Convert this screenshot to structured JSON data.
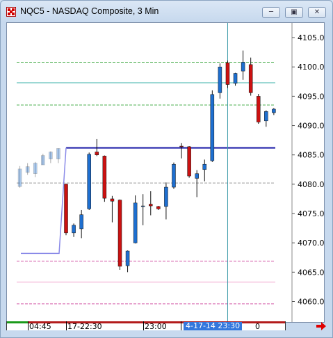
{
  "window": {
    "title": "NQC5 - NASDAQ Composite, 3 Min",
    "controls": {
      "minimize_icon": "minimize-icon",
      "restore_icon": "restore-icon",
      "close_icon": "close-icon"
    }
  },
  "time_axis": {
    "labels": [
      "04:45",
      "17-22:30",
      "23:00"
    ],
    "cursor_time": "4-17-14  23:30",
    "cursor_time_suffix": "0"
  },
  "colors": {
    "up": "#1e6fd0",
    "down": "#cc1111",
    "background": "#ffffff",
    "resistance_line": "#1a1aa8",
    "teal_line": "#38b0a8",
    "green_dash": "#4caf50",
    "pink_dash": "#d45aa8",
    "pink_solid": "#f0a0cc",
    "gray_dash": "#9a9a9a",
    "cursor": "#3a9aa8",
    "axis_label_bg": "#3377dd"
  },
  "chart_data": {
    "type": "candlestick",
    "title": "NQC5 - NASDAQ Composite, 3 Min",
    "ylim": [
      4056.5,
      4107.5
    ],
    "yticks": [
      4060.0,
      4065.0,
      4070.0,
      4075.0,
      4080.0,
      4085.0,
      4090.0,
      4095.0,
      4100.0,
      4105.0
    ],
    "ytick_labels": [
      "4060.0",
      "4065.0",
      "4070.0",
      "4075.0",
      "4080.0",
      "4085.0",
      "4090.0",
      "4095.0",
      "4100.0",
      "4105.0"
    ],
    "grid": false,
    "faded_candles": [
      {
        "i": -6,
        "o": 4079.6,
        "h": 4083.1,
        "c": 4082.6,
        "l": 4079.4
      },
      {
        "i": -5,
        "o": 4082.0,
        "h": 4083.6,
        "c": 4083.0,
        "l": 4081.6
      },
      {
        "i": -4,
        "o": 4081.8,
        "h": 4083.8,
        "c": 4083.6,
        "l": 4081.2
      },
      {
        "i": -3,
        "o": 4083.3,
        "h": 4085.2,
        "c": 4084.9,
        "l": 4083.3
      },
      {
        "i": -2,
        "o": 4084.3,
        "h": 4085.6,
        "c": 4085.5,
        "l": 4083.6
      },
      {
        "i": -1,
        "o": 4084.3,
        "h": 4086.1,
        "c": 4086.1,
        "l": 4083.6
      }
    ],
    "candles": [
      {
        "i": 0,
        "o": 4080.0,
        "h": 4080.1,
        "c": 4071.7,
        "l": 4071.3
      },
      {
        "i": 1,
        "o": 4071.7,
        "h": 4073.3,
        "c": 4073.0,
        "l": 4071.0
      },
      {
        "i": 2,
        "o": 4072.4,
        "h": 4075.6,
        "c": 4074.8,
        "l": 4070.8
      },
      {
        "i": 3,
        "o": 4075.8,
        "h": 4085.4,
        "c": 4085.1,
        "l": 4075.6
      },
      {
        "i": 4,
        "o": 4085.5,
        "h": 4087.7,
        "c": 4085.0,
        "l": 4084.8
      },
      {
        "i": 5,
        "o": 4084.8,
        "h": 4084.9,
        "c": 4077.6,
        "l": 4077.0
      },
      {
        "i": 6,
        "o": 4077.5,
        "h": 4078.0,
        "c": 4077.1,
        "l": 4073.5
      },
      {
        "i": 7,
        "o": 4077.3,
        "h": 4077.4,
        "c": 4066.0,
        "l": 4065.4
      },
      {
        "i": 8,
        "o": 4066.1,
        "h": 4068.7,
        "c": 4068.6,
        "l": 4065.0
      },
      {
        "i": 9,
        "o": 4070.0,
        "h": 4078.1,
        "c": 4076.8,
        "l": 4069.9
      },
      {
        "i": 10,
        "o": 4076.2,
        "h": 4078.3,
        "c": 4076.3,
        "l": 4073.0
      },
      {
        "i": 11,
        "o": 4076.6,
        "h": 4078.8,
        "c": 4076.3,
        "l": 4074.7
      },
      {
        "i": 12,
        "o": 4076.2,
        "h": 4076.3,
        "c": 4075.8,
        "l": 4075.6
      },
      {
        "i": 13,
        "o": 4076.2,
        "h": 4080.3,
        "c": 4079.5,
        "l": 4074.0
      },
      {
        "i": 14,
        "o": 4079.5,
        "h": 4083.7,
        "c": 4083.4,
        "l": 4079.2
      },
      {
        "i": 15,
        "o": 4086.5,
        "h": 4087.0,
        "c": 4086.4,
        "l": 4084.4
      },
      {
        "i": 16,
        "o": 4086.4,
        "h": 4086.5,
        "c": 4081.4,
        "l": 4081.1
      },
      {
        "i": 17,
        "o": 4081.0,
        "h": 4082.4,
        "c": 4081.8,
        "l": 4077.8
      },
      {
        "i": 18,
        "o": 4082.5,
        "h": 4084.2,
        "c": 4083.4,
        "l": 4080.5
      },
      {
        "i": 19,
        "o": 4084.0,
        "h": 4096.0,
        "c": 4095.3,
        "l": 4083.8
      },
      {
        "i": 20,
        "o": 4095.6,
        "h": 4100.6,
        "c": 4100.0,
        "l": 4094.6
      },
      {
        "i": 21,
        "o": 4100.7,
        "h": 4101.1,
        "c": 4097.0,
        "l": 4096.4
      },
      {
        "i": 22,
        "o": 4097.2,
        "h": 4099.0,
        "c": 4098.9,
        "l": 4096.8
      },
      {
        "i": 23,
        "o": 4099.3,
        "h": 4102.8,
        "c": 4100.8,
        "l": 4097.8
      },
      {
        "i": 24,
        "o": 4100.4,
        "h": 4101.6,
        "c": 4095.6,
        "l": 4095.1
      },
      {
        "i": 25,
        "o": 4095.0,
        "h": 4095.4,
        "c": 4090.6,
        "l": 4090.3
      },
      {
        "i": 26,
        "o": 4090.8,
        "h": 4092.6,
        "c": 4092.4,
        "l": 4089.8
      },
      {
        "i": 27,
        "o": 4092.2,
        "h": 4093.0,
        "c": 4092.8,
        "l": 4091.8
      }
    ],
    "levels": [
      {
        "name": "green-dash-upper",
        "price": 4100.8,
        "style": "dashed",
        "color": "green_dash"
      },
      {
        "name": "teal-line",
        "price": 4097.3,
        "style": "solid",
        "color": "teal_line"
      },
      {
        "name": "green-dash-lower",
        "price": 4093.5,
        "style": "dashed",
        "color": "green_dash"
      },
      {
        "name": "resistance-line",
        "price": 4086.2,
        "style": "solid-thick",
        "color": "resistance_line"
      },
      {
        "name": "gray-dash",
        "price": 4080.2,
        "style": "dashed",
        "color": "gray_dash"
      },
      {
        "name": "pink-dash-upper",
        "price": 4066.9,
        "style": "dashed",
        "color": "pink_dash"
      },
      {
        "name": "pink-solid",
        "price": 4063.3,
        "style": "solid",
        "color": "pink_solid"
      },
      {
        "name": "pink-dash-lower",
        "price": 4059.6,
        "style": "dashed",
        "color": "pink_dash"
      }
    ],
    "left_trace": {
      "flat_price": 4068.2,
      "end_candle": 0,
      "end_price": 4086.2,
      "color": "#8a8ae8"
    },
    "cursor": {
      "candle": 21,
      "price": 4100.8
    }
  }
}
